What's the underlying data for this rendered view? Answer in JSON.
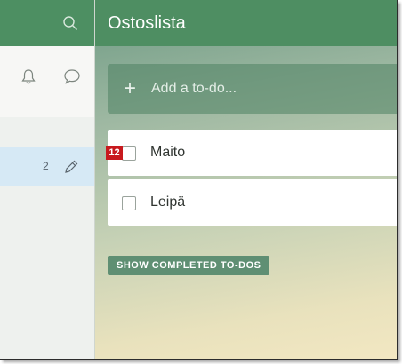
{
  "sidebar": {
    "list_count": "2"
  },
  "header": {
    "title": "Ostoslista"
  },
  "add_todo": {
    "placeholder": "Add a to-do..."
  },
  "todos": [
    {
      "label": "Maito",
      "badge": "12"
    },
    {
      "label": "Leipä"
    }
  ],
  "show_completed_label": "SHOW COMPLETED TO-DOS",
  "colors": {
    "accent_green": "#4e8e62",
    "selected_list_bg": "#d6e9f5",
    "badge_red": "#c8191e"
  }
}
